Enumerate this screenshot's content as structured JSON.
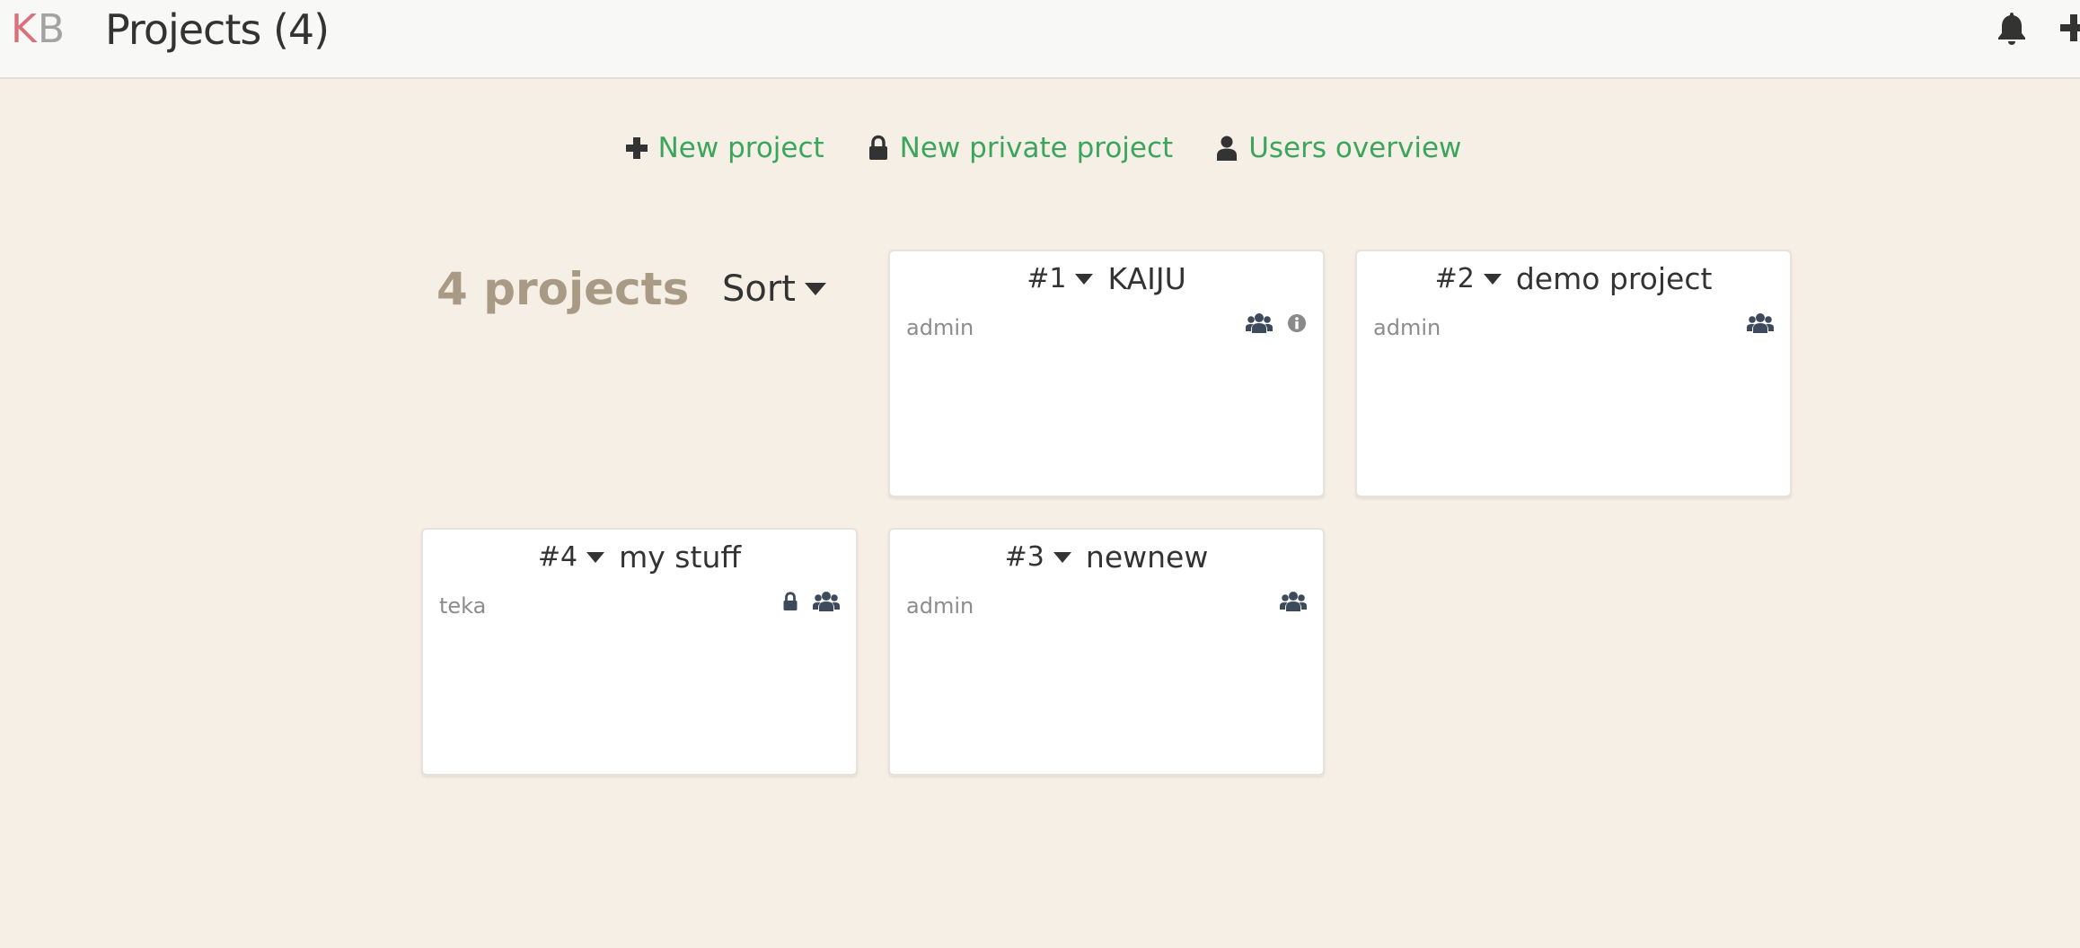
{
  "header": {
    "logo_k": "K",
    "logo_b": "B",
    "title": "Projects (4)",
    "icons": [
      "bell-icon",
      "plus-icon"
    ]
  },
  "actions": [
    {
      "label": "New project",
      "icon": "plus-icon"
    },
    {
      "label": "New private project",
      "icon": "lock-icon"
    },
    {
      "label": "Users overview",
      "icon": "user-icon"
    }
  ],
  "summary": {
    "count_label": "4 projects",
    "sort_label": "Sort"
  },
  "projects": [
    {
      "number": "#1",
      "name": "KAIJU",
      "owner": "admin",
      "icons": [
        "users-icon",
        "info-icon"
      ]
    },
    {
      "number": "#2",
      "name": "demo project",
      "owner": "admin",
      "icons": [
        "users-icon"
      ]
    },
    {
      "number": "#4",
      "name": "my stuff",
      "owner": "teka",
      "icons": [
        "lock-icon",
        "users-icon"
      ]
    },
    {
      "number": "#3",
      "name": "newnew",
      "owner": "admin",
      "icons": [
        "users-icon"
      ]
    }
  ],
  "colors": {
    "background": "#f6efe6",
    "header": "#f8f8f6",
    "link": "#3ba55c",
    "count": "#a89a84",
    "logo_k": "#d9707c",
    "logo_b": "#a3a3a3",
    "icon_dark": "#3d4a5c"
  }
}
